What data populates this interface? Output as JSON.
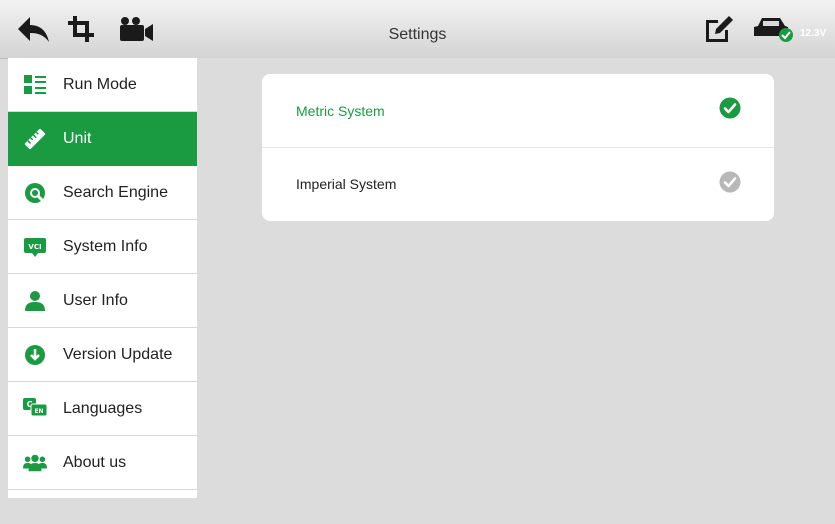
{
  "header": {
    "title": "Settings",
    "voltage": "12.3V",
    "icons": [
      "back-icon",
      "crop-icon",
      "video-camera-icon",
      "edit-icon",
      "car-connected-icon"
    ]
  },
  "sidebar": {
    "items": [
      {
        "label": "Run Mode",
        "icon": "run-mode-icon",
        "active": false
      },
      {
        "label": "Unit",
        "icon": "ruler-icon",
        "active": true
      },
      {
        "label": "Search Engine",
        "icon": "search-engine-icon",
        "active": false
      },
      {
        "label": "System Info",
        "icon": "vci-icon",
        "active": false
      },
      {
        "label": "User Info",
        "icon": "user-icon",
        "active": false
      },
      {
        "label": "Version Update",
        "icon": "download-icon",
        "active": false
      },
      {
        "label": "Languages",
        "icon": "language-icon",
        "active": false
      },
      {
        "label": "About us",
        "icon": "group-icon",
        "active": false
      }
    ]
  },
  "unit_options": [
    {
      "label": "Metric System",
      "selected": true
    },
    {
      "label": "Imperial System",
      "selected": false
    }
  ],
  "colors": {
    "accent": "#1a9b41",
    "unselected_check": "#b8b8b8",
    "background": "#dcdcdc"
  }
}
